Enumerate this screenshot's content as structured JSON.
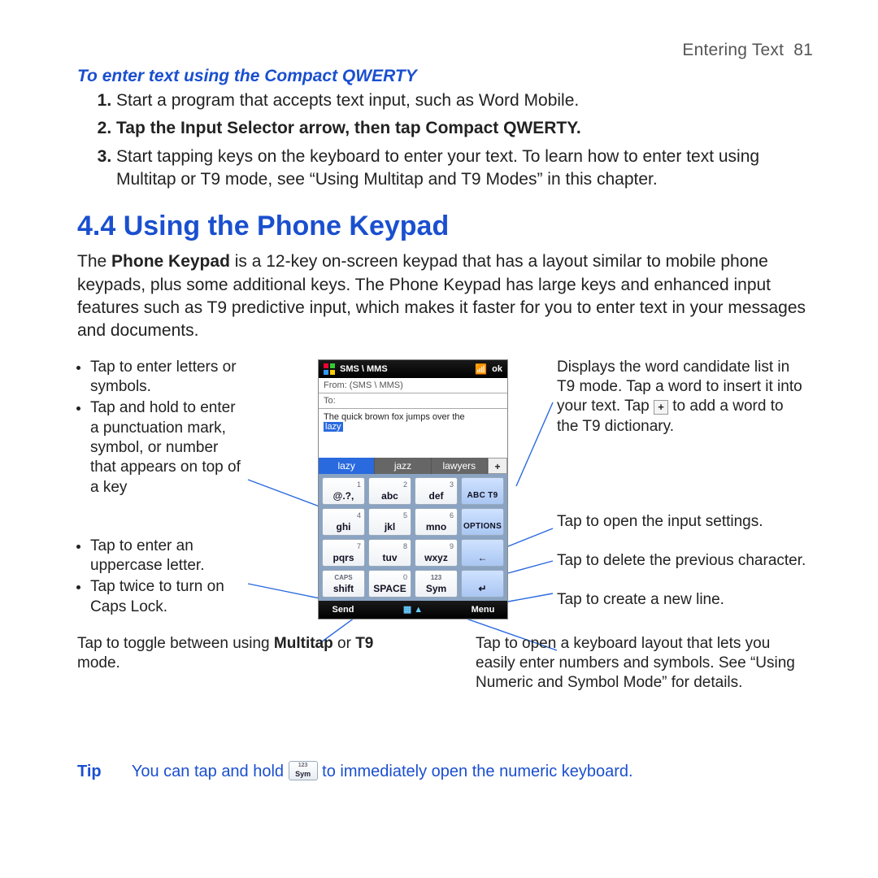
{
  "header": {
    "chapter": "Entering Text",
    "page": "81"
  },
  "compact_qwerty": {
    "heading": "To enter text using the Compact QWERTY",
    "step1": "Start a program that accepts text input, such as Word Mobile.",
    "step2_a": "Tap the ",
    "step2_b": "Input Selector",
    "step2_c": " arrow, then tap ",
    "step2_d": "Compact QWERTY",
    "step2_e": ".",
    "step3": "Start tapping keys on the keyboard to enter your text. To learn how to enter text using Multitap or T9 mode, see “Using Multitap and T9 Modes” in this chapter."
  },
  "section": {
    "title": "4.4 Using the Phone Keypad",
    "intro_a": "The ",
    "intro_b": "Phone Keypad",
    "intro_c": " is a 12-key on-screen keypad that has a layout similar to mobile phone keypads, plus some additional keys. The Phone Keypad has large keys and enhanced input features such as T9 predictive input, which makes it faster for you to enter text in your messages and documents."
  },
  "callouts": {
    "left1a": "Tap to enter letters or symbols.",
    "left1b": "Tap and hold to enter a punctuation mark, symbol, or number that appears on top of a key",
    "left2a": "Tap to enter an uppercase letter.",
    "left2b": "Tap twice to turn on Caps Lock.",
    "bottom_left_a": "Tap to toggle between using ",
    "bottom_left_b": "Multitap",
    "bottom_left_c": " or ",
    "bottom_left_d": "T9",
    "bottom_left_e": " mode.",
    "right1": "Displays the word candidate list in T9 mode. Tap a word to insert it into your text. Tap ",
    "right1_tail": " to add a word to the T9 dictionary.",
    "right2": "Tap to open the input settings.",
    "right3": "Tap to delete the previous character.",
    "right4": "Tap to create a new line.",
    "bottom_right": "Tap to open a keyboard layout that lets you easily enter numbers and symbols. See “Using Numeric and Symbol Mode” for details."
  },
  "phone": {
    "title": "SMS \\ MMS",
    "ok": "ok",
    "from": "From: (SMS \\ MMS)",
    "to": "To:",
    "typed": "The quick brown fox jumps over the",
    "selword": "lazy",
    "candidates": [
      "lazy",
      "jazz",
      "lawyers"
    ],
    "plus": "+",
    "keys": {
      "r1": [
        {
          "num": "1",
          "lbl": "@.?,"
        },
        {
          "num": "2",
          "lbl": "abc"
        },
        {
          "num": "3",
          "lbl": "def"
        },
        {
          "lbl": "ABC T9",
          "top": ""
        }
      ],
      "r2": [
        {
          "num": "4",
          "lbl": "ghi"
        },
        {
          "num": "5",
          "lbl": "jkl"
        },
        {
          "num": "6",
          "lbl": "mno"
        },
        {
          "lbl": "OPTIONS"
        }
      ],
      "r3": [
        {
          "num": "7",
          "lbl": "pqrs"
        },
        {
          "num": "8",
          "lbl": "tuv"
        },
        {
          "num": "9",
          "lbl": "wxyz"
        },
        {
          "lbl": "←"
        }
      ],
      "r4": [
        {
          "top": "CAPS",
          "lbl": "shift"
        },
        {
          "num": "0",
          "lbl": "SPACE"
        },
        {
          "top": "123",
          "lbl": "Sym"
        },
        {
          "lbl": "↵"
        }
      ]
    },
    "softkeys": {
      "left": "Send",
      "mid": "▦ ▲",
      "right": "Menu"
    }
  },
  "tip": {
    "label": "Tip",
    "a": "You can tap and hold ",
    "b": " to immediately open the numeric keyboard."
  }
}
